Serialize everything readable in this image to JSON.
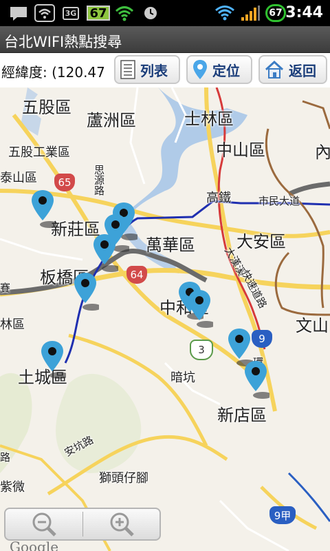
{
  "status_bar": {
    "battery_level": "67",
    "signal_badge": "67",
    "time": "3:44",
    "network_type": "3G"
  },
  "app": {
    "title": "台北WIFI熱點搜尋"
  },
  "toolbar": {
    "coordinate_text": "經緯度: (120.47",
    "list_label": "列表",
    "locate_label": "定位",
    "back_label": "返回"
  },
  "map": {
    "labels": [
      "五股區",
      "蘆洲區",
      "士林區",
      "中山區",
      "內",
      "五股工業區",
      "泰山區",
      "新莊區",
      "萬華區",
      "大安區",
      "板橋區",
      "中和區",
      "文山",
      "林區",
      "土城區",
      "暗坑",
      "新店區",
      "安坑路",
      "紫微",
      "獅頭仔腳",
      "市民大道",
      "高鐵",
      "大漢溪",
      "快速道路",
      "路",
      "賽",
      "環",
      "思源路"
    ],
    "route_shields": [
      "65",
      "64",
      "3",
      "9",
      "9甲"
    ],
    "attribution": "Google"
  },
  "colors": {
    "accent_text": "#1a3d7a",
    "status_green": "#2fc12f",
    "title_bar": "#4a4a4a"
  }
}
